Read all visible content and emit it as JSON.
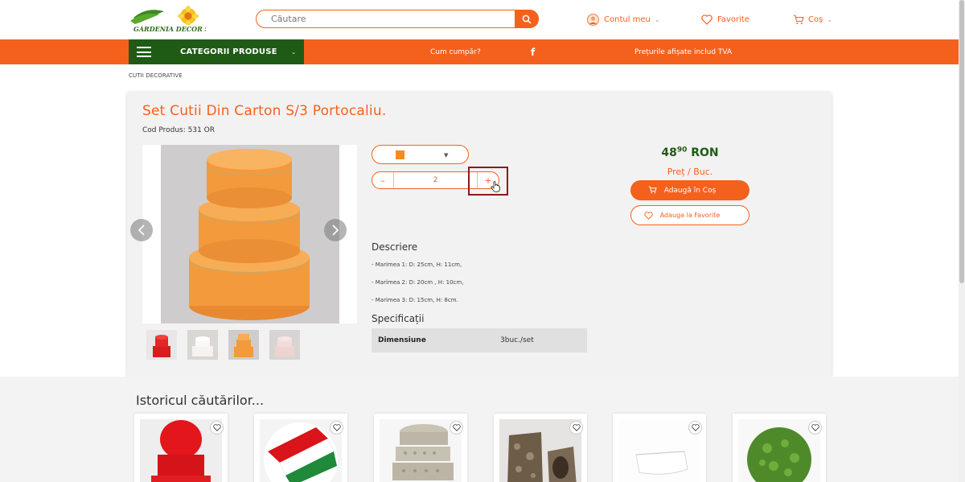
{
  "header": {
    "logo_text": "GARDENIA DECOR SRL",
    "search_placeholder": "Căutare",
    "account_label": "Contul meu",
    "favorites_label": "Favorite",
    "cart_label": "Coș"
  },
  "nav": {
    "categories_label": "CATEGORII PRODUSE",
    "how_to_buy": "Cum cumpăr?",
    "facebook": "f",
    "vat_note": "Prețurile afișate includ TVA"
  },
  "breadcrumb": "CUTII DECORATIVE",
  "product": {
    "title": "Set Cutii Din Carton S/3 Portocaliu.",
    "code": "Cod Produs: 531 OR",
    "variant_color": "#f58a1f",
    "quantity": "2",
    "qty_minus": "–",
    "qty_plus": "+",
    "price_int": "48",
    "price_dec": "90",
    "currency": "RON",
    "unit_label": "Preț / Buc.",
    "add_to_cart": "Adaugă în Coș",
    "add_to_favorites": "Adauga la Favorite",
    "description_title": "Descriere",
    "description_lines": [
      "- Marimea 1: D: 25cm, H: 11cm,",
      "- Marimea 2: D: 20cm , H: 10cm,",
      "- Marimea 3: D: 15cm, H: 8cm."
    ],
    "specs_title": "Specificații",
    "specs": [
      {
        "key": "Dimensiune",
        "value": "3buc./set"
      }
    ],
    "thumbnails": [
      "red-boxes",
      "white-boxes",
      "orange-boxes",
      "pink-boxes"
    ]
  },
  "history": {
    "title": "Istoricul căutărilor...",
    "items": [
      "red-hat-boxes",
      "tricolor-ribbon",
      "patterned-boxes",
      "cork-pot",
      "white-planter",
      "boxwood-ball"
    ]
  },
  "colors": {
    "accent": "#f4611d",
    "green": "#1f5b15"
  }
}
